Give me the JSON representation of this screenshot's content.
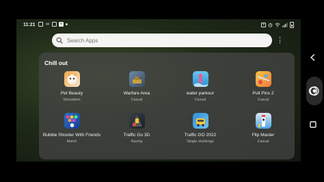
{
  "status_bar": {
    "time": "11:21",
    "icons": [
      "messenger-icon",
      "infinity-icon",
      "clipboard-icon",
      "v-app-icon",
      "dot-icon"
    ],
    "right_icons": [
      "no-sim-icon",
      "alarm-icon",
      "wifi-icon",
      "signal-icon",
      "battery-icon"
    ]
  },
  "search": {
    "placeholder": "Search Apps"
  },
  "folder": {
    "title": "Chill out",
    "apps": [
      {
        "name": "Pet Beauty",
        "genre": "Simulation",
        "icon": "pet-beauty-icon",
        "colors": [
          "#f2a84a",
          "#f7e6d0"
        ]
      },
      {
        "name": "Warfare Area",
        "genre": "Casual",
        "icon": "warfare-area-icon",
        "colors": [
          "#6b88a8",
          "#c9a23c"
        ]
      },
      {
        "name": "water parkour",
        "genre": "Casual",
        "icon": "water-parkour-icon",
        "colors": [
          "#37a7e8",
          "#e85d8c"
        ]
      },
      {
        "name": "Pull Pins 2",
        "genre": "Casual",
        "icon": "pull-pins-icon",
        "colors": [
          "#f07a3c",
          "#f5c542"
        ]
      },
      {
        "name": "Bubble Shooter With Friends",
        "genre": "Match",
        "icon": "bubble-shooter-icon",
        "colors": [
          "#2c6fd6",
          "#e84a7a"
        ]
      },
      {
        "name": "Traffic Go 3D",
        "genre": "Racing",
        "icon": "traffic-go-3d-icon",
        "colors": [
          "#3a3f48",
          "#f2c23a"
        ]
      },
      {
        "name": "Traffic GO 2022",
        "genre": "Single challenge",
        "icon": "traffic-go-2022-icon",
        "colors": [
          "#2f8fd8",
          "#f6c53c"
        ]
      },
      {
        "name": "Flip Master",
        "genre": "Casual",
        "icon": "flip-master-icon",
        "colors": [
          "#4aa3e8",
          "#e0e8f0"
        ]
      }
    ]
  },
  "nav": {
    "back": "back-icon",
    "home": "home-icon",
    "recent": "recents-icon"
  }
}
